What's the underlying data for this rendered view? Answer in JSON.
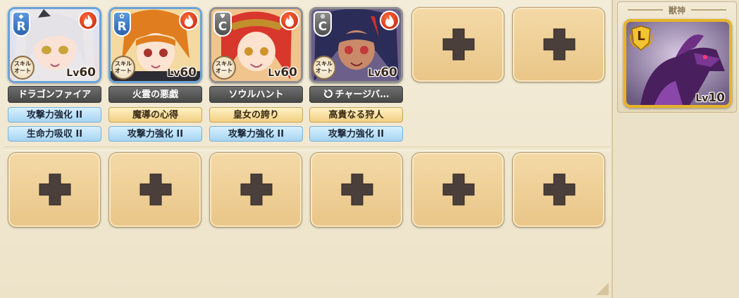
{
  "party": [
    {
      "rank": "R",
      "element": "fire",
      "level_prefix": "Lv",
      "level": "60",
      "skill_badge": "スキル\nオート",
      "skill": "ドラゴンファイア",
      "traits": [
        "攻撃力強化 II",
        "生命力吸収 II"
      ]
    },
    {
      "rank": "R",
      "element": "fire",
      "level_prefix": "Lv",
      "level": "60",
      "skill_badge": "スキル\nオート",
      "skill": "火霊の悪戯",
      "traits": [
        "魔導の心得",
        "攻撃力強化 II"
      ]
    },
    {
      "rank": "C",
      "element": "fire",
      "level_prefix": "Lv",
      "level": "60",
      "skill_badge": "スキル\nオート",
      "skill": "ソウルハント",
      "traits": [
        "皇女の誇り",
        "攻撃力強化 II"
      ]
    },
    {
      "rank": "C",
      "element": "fire",
      "level_prefix": "Lv",
      "level": "60",
      "skill_badge": "スキル\nオート",
      "skill": "チャージバ…",
      "traits": [
        "高貴なる狩人",
        "攻撃力強化 II"
      ]
    }
  ],
  "beast": {
    "title": "獣神",
    "rank": "L",
    "level_prefix": "Lv",
    "level": "10"
  },
  "colors": {
    "fire": "#d9331a",
    "rare_frame": "#6aa3da",
    "common_frame": "#8f8f8f",
    "legend_frame": "#e6b42a",
    "slot_fill": "#efd197",
    "plus": "#4a3f3b"
  }
}
